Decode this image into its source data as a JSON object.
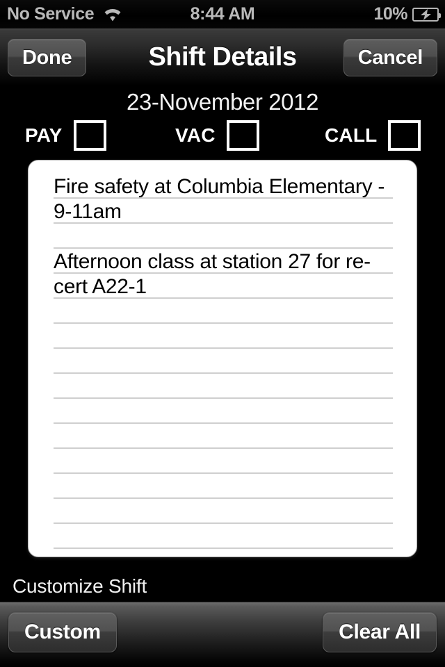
{
  "status_bar": {
    "carrier": "No Service",
    "wifi_icon": "wifi-icon",
    "time": "8:44 AM",
    "battery_percent": "10%",
    "battery_icon": "battery-charging-icon"
  },
  "nav_bar": {
    "done_label": "Done",
    "title": "Shift Details",
    "cancel_label": "Cancel"
  },
  "date": "23-November 2012",
  "flags": [
    {
      "label": "PAY",
      "checked": false
    },
    {
      "label": "VAC",
      "checked": false
    },
    {
      "label": "CALL",
      "checked": false
    }
  ],
  "notes": {
    "lines": [
      "Fire safety at Columbia Elementary -",
      "9-11am",
      "",
      "Afternoon class at station 27 for re-",
      "cert A22-1",
      "",
      "",
      "",
      "",
      "",
      "",
      "",
      "",
      "",
      ""
    ],
    "rule_count": 15
  },
  "customize_label": "Customize Shift",
  "toolbar": {
    "custom_label": "Custom",
    "clear_all_label": "Clear All"
  },
  "colors": {
    "background": "#000000",
    "card": "#ffffff",
    "rule_line": "#cfcfcf",
    "status_text": "#b9b9b9",
    "primary_text": "#ffffff"
  }
}
